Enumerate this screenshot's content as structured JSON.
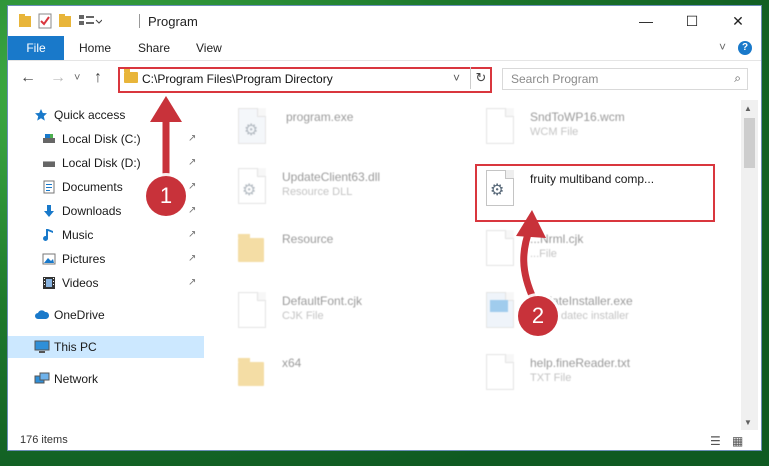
{
  "window": {
    "title": "Program",
    "controls": {
      "minimize": "—",
      "maximize": "☐",
      "close": "✕"
    }
  },
  "ribbon": {
    "tabs": [
      "File",
      "Home",
      "Share",
      "View"
    ],
    "expand": "˅",
    "help": "?"
  },
  "nav": {
    "back": "←",
    "forward": "→",
    "recent": "˅",
    "up": "↑",
    "address": "C:\\Program Files\\Program Directory",
    "address_dropdown": "˅",
    "refresh": "↻",
    "search_placeholder": "Search Program",
    "search_icon": "⌕"
  },
  "sidebar": {
    "items": [
      {
        "label": "Quick access",
        "icon": "star-icon"
      },
      {
        "label": "Local Disk (C:)",
        "icon": "drive-icon",
        "pinned": true
      },
      {
        "label": "Local Disk (D:)",
        "icon": "drive-icon",
        "pinned": true
      },
      {
        "label": "Documents",
        "icon": "documents-icon",
        "pinned": true
      },
      {
        "label": "Downloads",
        "icon": "download-icon",
        "pinned": true
      },
      {
        "label": "Music",
        "icon": "music-icon",
        "pinned": true
      },
      {
        "label": "Pictures",
        "icon": "pictures-icon",
        "pinned": true
      },
      {
        "label": "Videos",
        "icon": "videos-icon",
        "pinned": true
      },
      {
        "label": "OneDrive",
        "icon": "cloud-icon"
      },
      {
        "label": "This PC",
        "icon": "computer-icon"
      },
      {
        "label": "Network",
        "icon": "network-icon"
      }
    ],
    "pin_glyph": "↗"
  },
  "files": [
    {
      "name": "program.exe",
      "type": ""
    },
    {
      "name": "SndToWP16.wcm",
      "type": "WCM File"
    },
    {
      "name": "UpdateClient63.dll",
      "type": "Resource DLL"
    },
    {
      "name": "fruity multiband comp...",
      "type": ""
    },
    {
      "name": "Resource",
      "type": ""
    },
    {
      "name": "...Nrml.cjk",
      "type": "...File"
    },
    {
      "name": "DefaultFont.cjk",
      "type": "CJK File"
    },
    {
      "name": "UpdateInstaller.exe",
      "type": "...T updatec installer"
    },
    {
      "name": "x64",
      "type": ""
    },
    {
      "name": "help.fineReader.txt",
      "type": "TXT File"
    }
  ],
  "status": {
    "count": "176 items"
  },
  "callouts": {
    "one": "1",
    "two": "2"
  },
  "colors": {
    "accent": "#1979ca",
    "highlight": "#d9363e",
    "callout": "#c8323a",
    "selected": "#cce8ff"
  }
}
